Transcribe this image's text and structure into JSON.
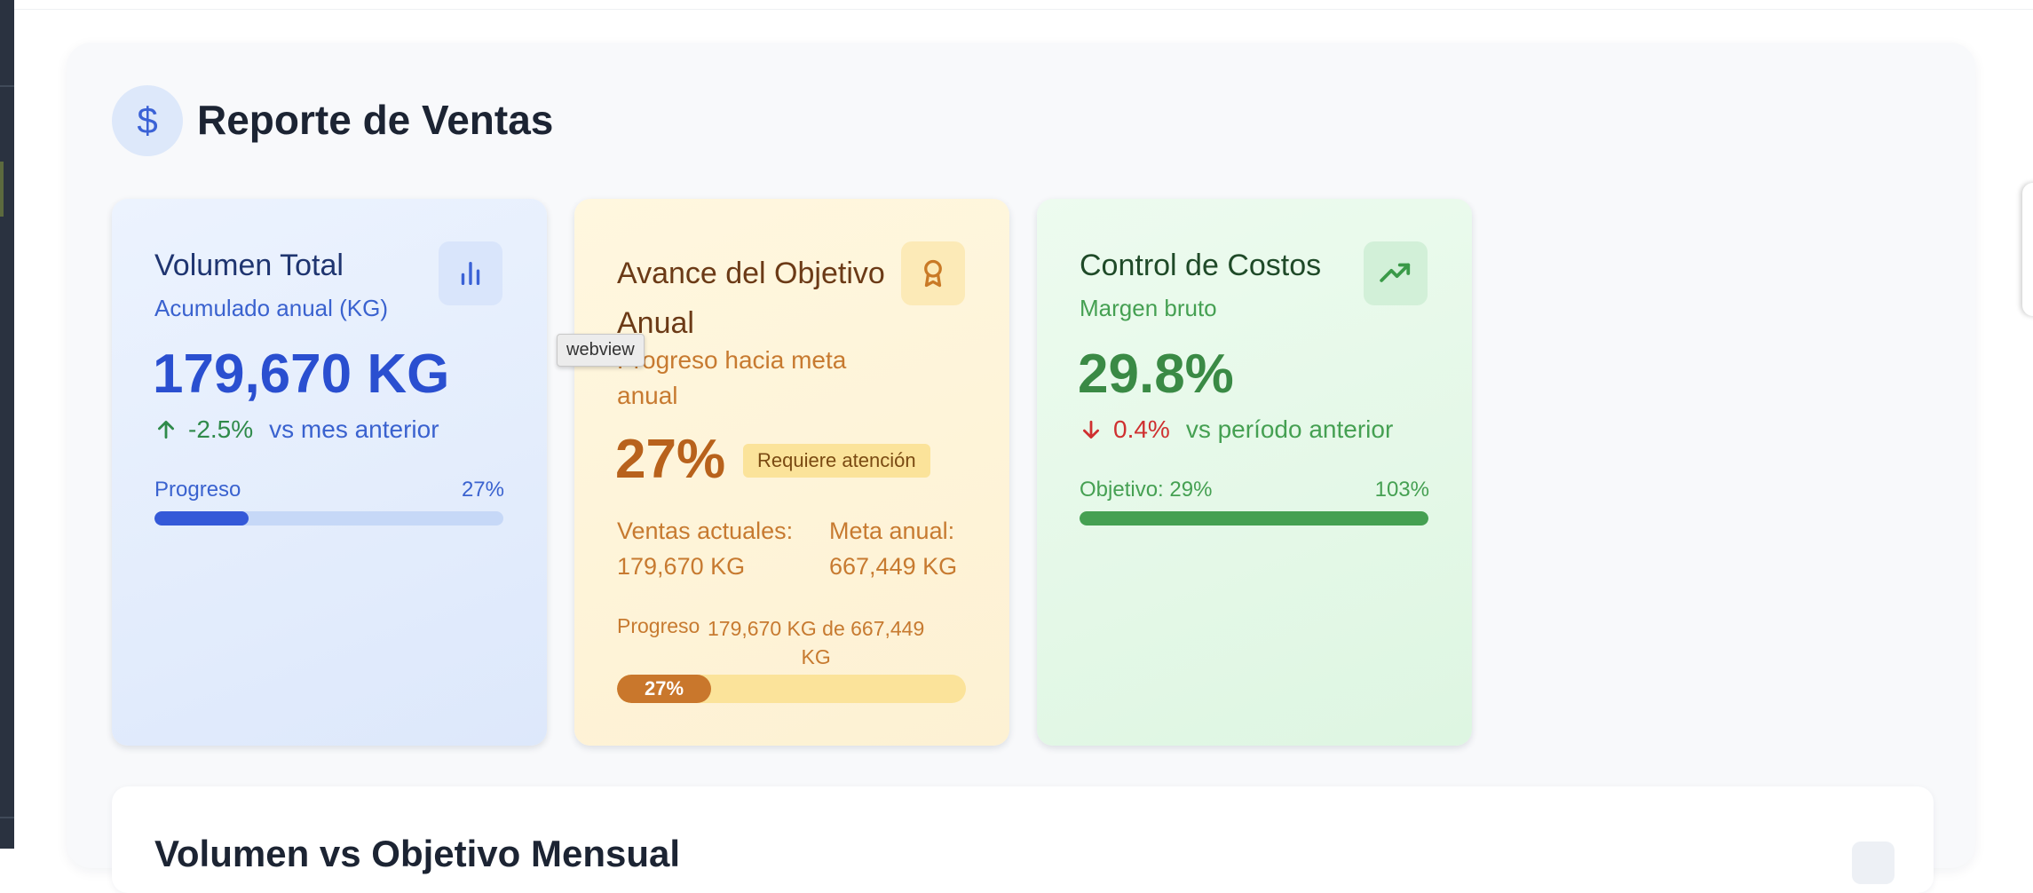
{
  "header": {
    "title": "Reporte de Ventas",
    "icon": "dollar-icon"
  },
  "tooltip": "webview",
  "cards": {
    "volume": {
      "title": "Volumen Total",
      "subtitle": "Acumulado anual (KG)",
      "value": "179,670 KG",
      "trend_value": "-2.5%",
      "trend_label": "vs mes anterior",
      "trend_direction": "up",
      "progress_label": "Progreso",
      "progress_pct_label": "27%",
      "progress": 0.27,
      "icon": "bar-chart-icon",
      "accent": "#3355d6"
    },
    "goal": {
      "title_line1": "Avance del Objetivo",
      "title_line2": "Anual",
      "subtitle_line1": "Progreso hacia meta",
      "subtitle_line2": "anual",
      "value": "27%",
      "badge": "Requiere atención",
      "current_label": "Ventas actuales:",
      "current_value": "179,670 KG",
      "target_label": "Meta anual:",
      "target_value": "667,449 KG",
      "progress_label": "Progreso",
      "progress_detail_line1": "179,670 KG de 667,449",
      "progress_detail_line2": "KG",
      "bar_label": "27%",
      "progress": 0.27,
      "icon": "award-icon",
      "accent": "#b8621c"
    },
    "cost": {
      "title": "Control de Costos",
      "subtitle": "Margen bruto",
      "value": "29.8%",
      "trend_value": "0.4%",
      "trend_label": "vs período anterior",
      "trend_direction": "down",
      "objective_label": "Objetivo: 29%",
      "objective_pct": "103%",
      "progress": 1.0,
      "icon": "trending-up-icon",
      "accent": "#3a8a45"
    }
  },
  "bottom_section": {
    "title": "Volumen vs Objetivo Mensual"
  }
}
